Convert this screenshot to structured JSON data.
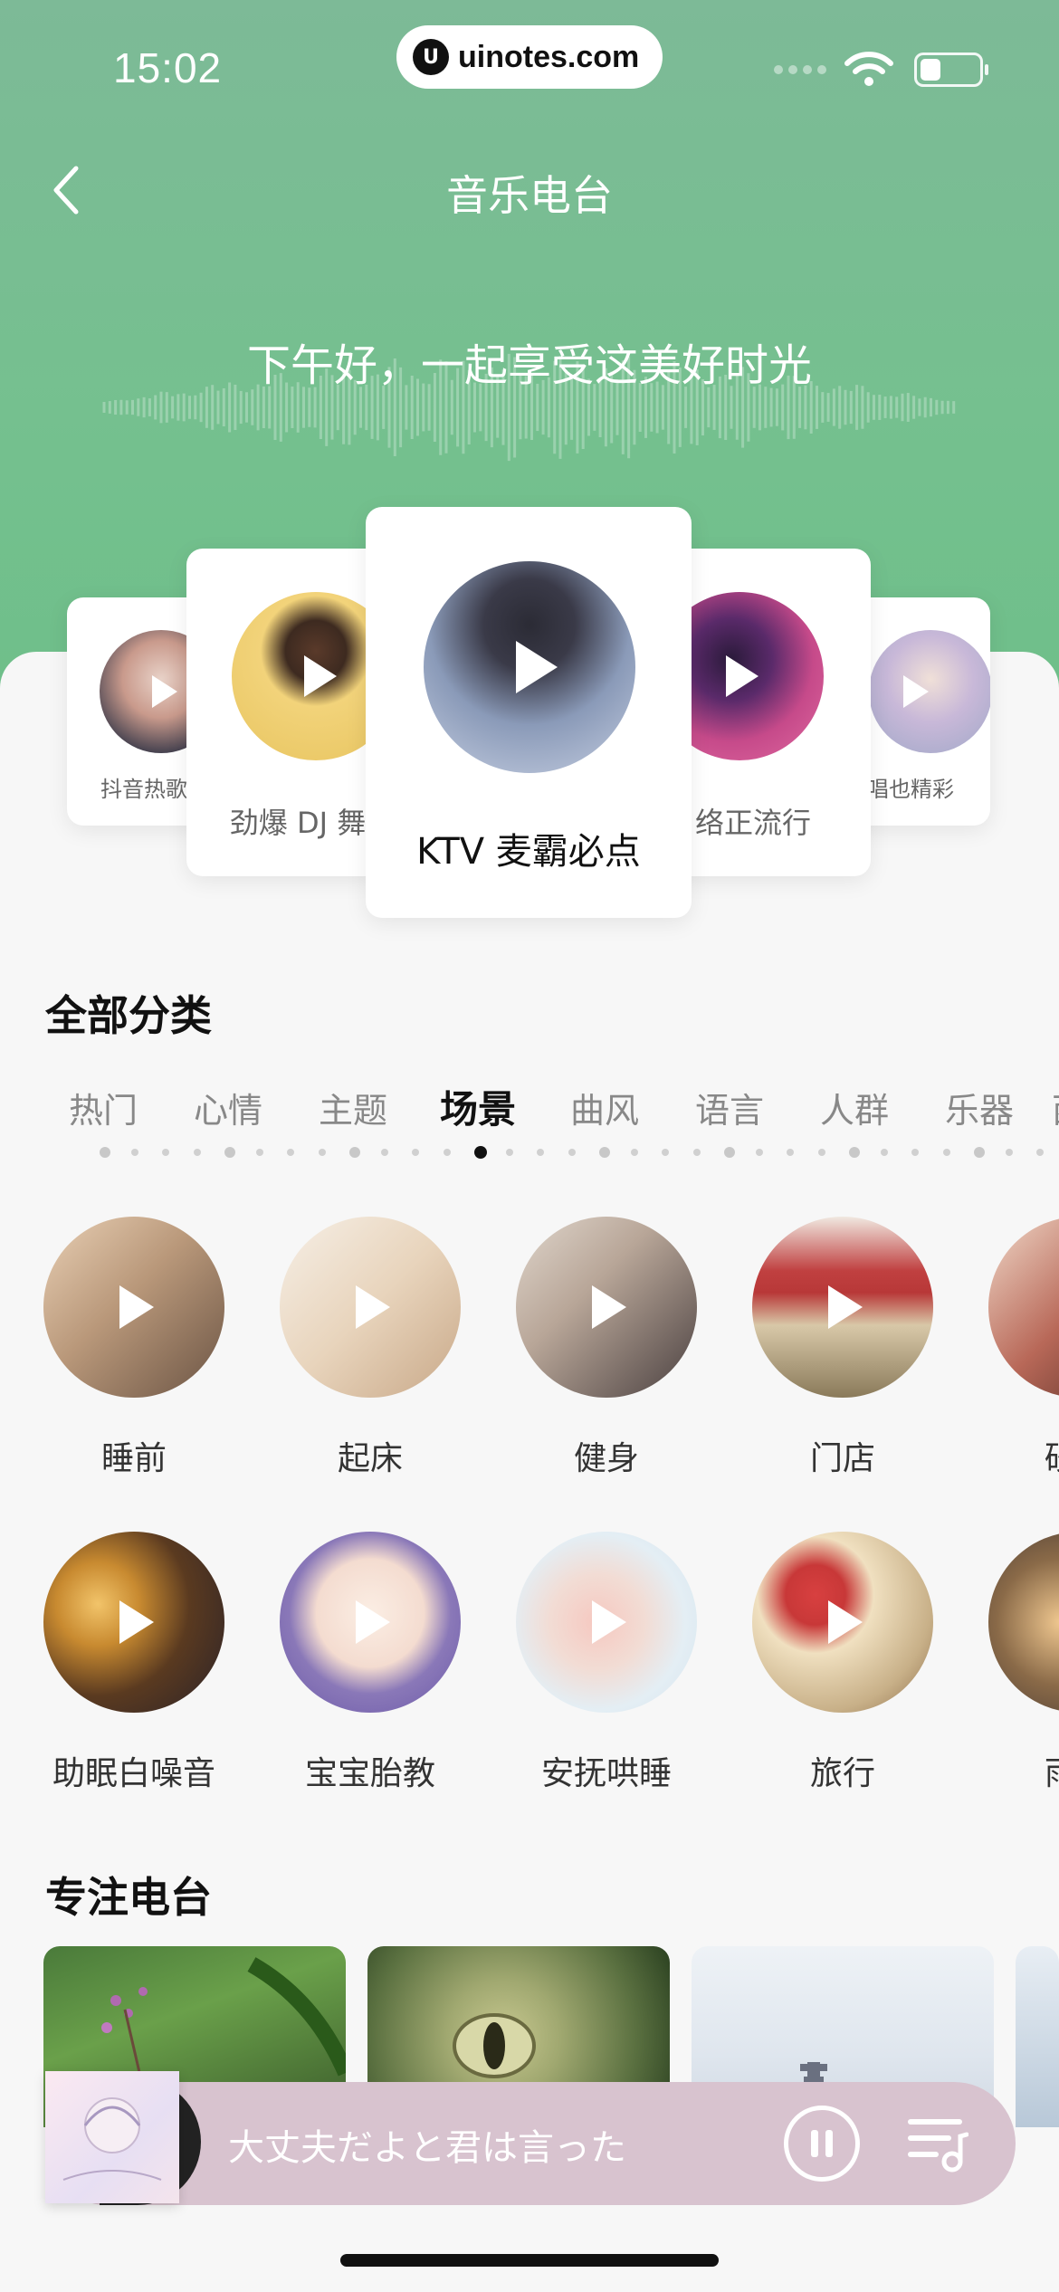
{
  "status_bar": {
    "time": "15:02",
    "url": "uinotes.com",
    "url_logo": "U"
  },
  "nav": {
    "title": "音乐电台"
  },
  "hero": {
    "greeting": "下午好，一起享受这美好时光"
  },
  "carousel": [
    {
      "label": "抖音热歌",
      "icon": "play-icon"
    },
    {
      "label": "劲爆 DJ 舞",
      "icon": "play-icon"
    },
    {
      "label": "KTV 麦霸必点",
      "icon": "play-icon"
    },
    {
      "label": "络正流行",
      "icon": "play-icon"
    },
    {
      "label": "唱也精彩",
      "icon": "play-icon"
    }
  ],
  "categories": {
    "title": "全部分类",
    "tabs": [
      "热门",
      "心情",
      "主题",
      "场景",
      "曲风",
      "语言",
      "人群",
      "乐器",
      "西"
    ],
    "active_tab": "场景",
    "items_row1": [
      "睡前",
      "起床",
      "健身",
      "门店",
      "砂"
    ],
    "items_row2": [
      "助眠白噪音",
      "宝宝胎教",
      "安抚哄睡",
      "旅行",
      "雨"
    ]
  },
  "focus": {
    "title": "专注电台"
  },
  "player": {
    "song": "大丈夫だよと君は言った"
  },
  "colors": {
    "accent_green": "#75c08f",
    "player_bg": "#d8c3cf"
  }
}
